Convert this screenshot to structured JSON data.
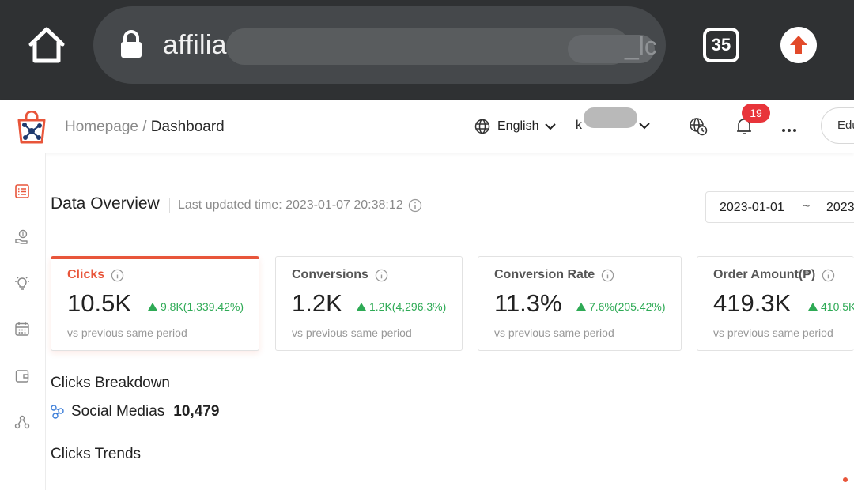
{
  "browser": {
    "url_visible": "affilia",
    "url_tail": "_lc",
    "tab_count": "35"
  },
  "header": {
    "breadcrumb_home": "Homepage /",
    "breadcrumb_current": "Dashboard",
    "language": "English",
    "user_initial": "k",
    "notification_count": "19",
    "edu_button": "Edu"
  },
  "overview": {
    "title": "Data Overview",
    "updated_label": "Last updated time: 2023-01-07 20:38:12",
    "date_start": "2023-01-01",
    "date_sep": "~",
    "date_end": "2023"
  },
  "cards": [
    {
      "label": "Clicks",
      "value": "10.5K",
      "delta": "9.8K(1,339.42%)",
      "sub": "vs previous same period"
    },
    {
      "label": "Conversions",
      "value": "1.2K",
      "delta": "1.2K(4,296.3%)",
      "sub": "vs previous same period"
    },
    {
      "label": "Conversion Rate",
      "value": "11.3%",
      "delta": "7.6%(205.42%)",
      "sub": "vs previous same period"
    },
    {
      "label": "Order Amount(₱)",
      "value": "419.3K",
      "delta": "410.5K",
      "sub": "vs previous same period"
    }
  ],
  "breakdown": {
    "title": "Clicks Breakdown",
    "source": "Social Medias",
    "count": "10,479"
  },
  "trends": {
    "title": "Clicks Trends"
  },
  "colors": {
    "accent": "#e8553a",
    "positive": "#2eaa55",
    "badge": "#e8343a"
  }
}
